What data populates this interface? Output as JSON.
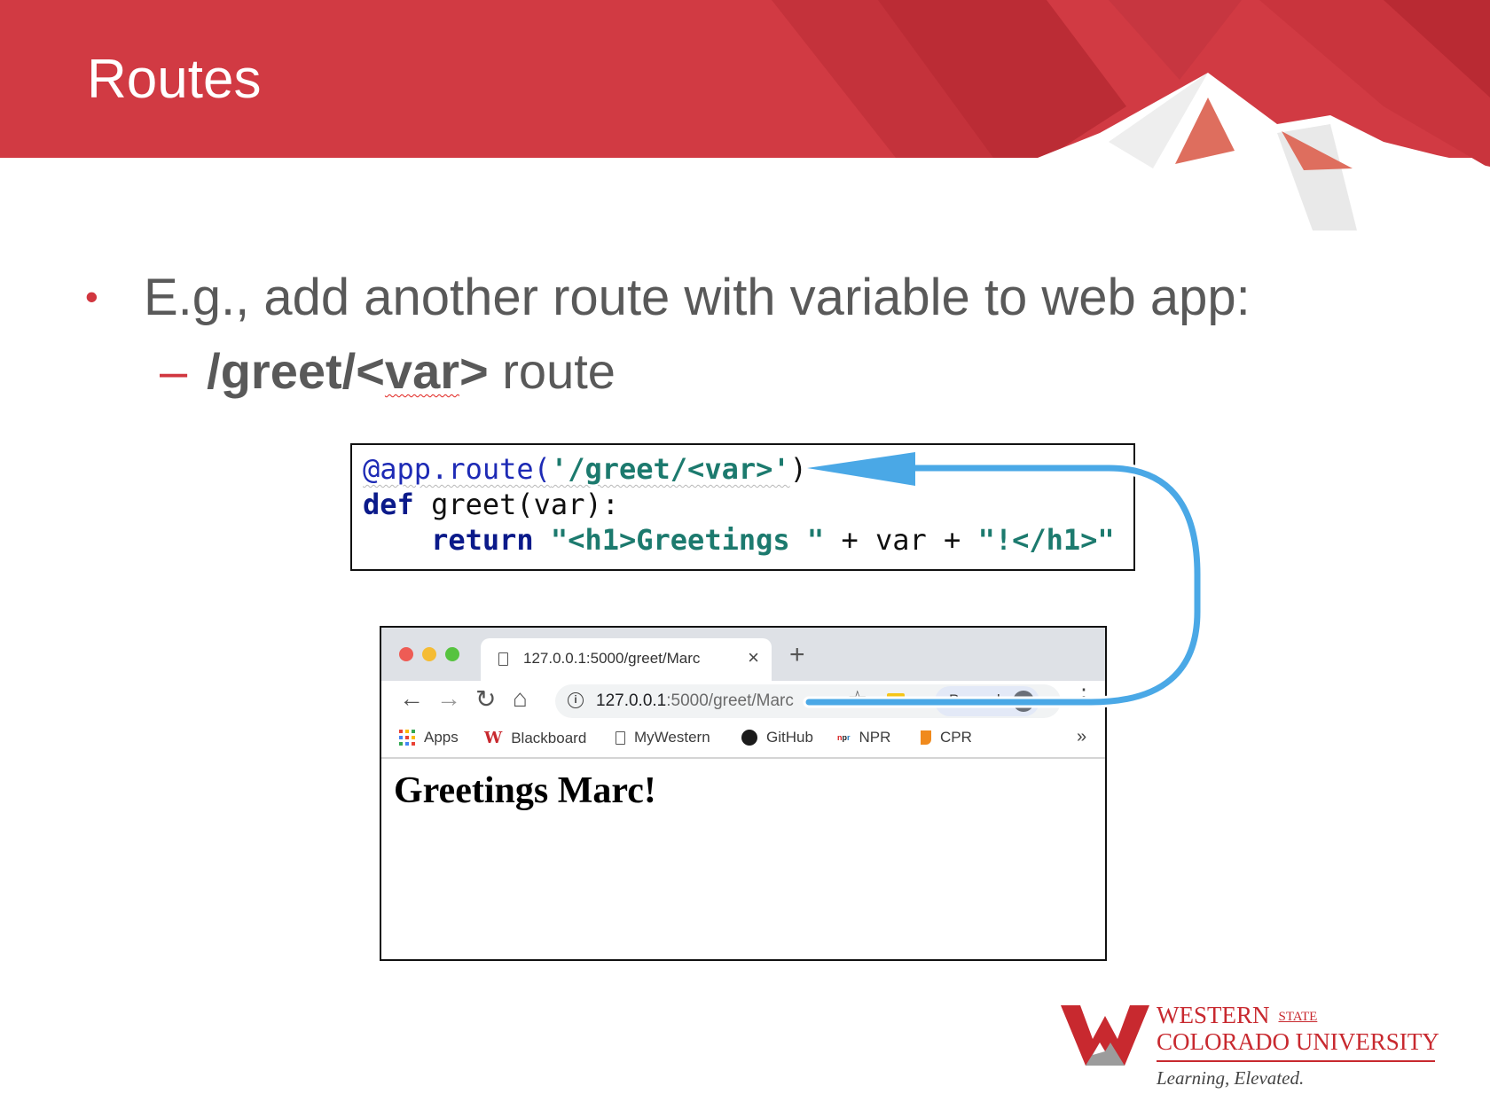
{
  "slide": {
    "title": "Routes",
    "bullet_main": "E.g., add another route with variable to web app:",
    "bullet_dot": "•",
    "sub_dash": "–",
    "sub_route_prefix": "/greet/<",
    "sub_route_var": "var",
    "sub_route_suffix": ">",
    "sub_text": " route"
  },
  "code": {
    "line1": {
      "decorator": "@app.route(",
      "string": "'/greet/<var>'",
      "close": ")"
    },
    "line2": {
      "keyword": "def",
      "rest": " greet(var):"
    },
    "line3": {
      "indent": "    ",
      "keyword": "return",
      "string1": " \"<h1>Greetings \"",
      "mid": " + var + ",
      "string2": "\"!</h1>\""
    }
  },
  "browser": {
    "tab_title": "127.0.0.1:5000/greet/Marc",
    "tab_close": "×",
    "new_tab": "+",
    "nav": {
      "back": "←",
      "forward": "→",
      "reload": "↻",
      "home": "⌂"
    },
    "url_host": "127.0.0.1",
    "url_path": ":5000/greet/Marc",
    "info": "i",
    "star": "☆",
    "profile_label": "Paused",
    "menu": "⋮",
    "bookmarks": [
      "Apps",
      "Blackboard",
      "MyWestern",
      "GitHub",
      "NPR",
      "CPR"
    ],
    "bookmarks_more": "»",
    "npr_mark": "npr",
    "page_heading": "Greetings Marc!"
  },
  "logo": {
    "line1": "WESTERN",
    "state": "STATE",
    "line2": "COLORADO UNIVERSITY",
    "tagline": "Learning, Elevated."
  },
  "colors": {
    "brand_red": "#c8292f",
    "arrow_blue": "#4aa8e6",
    "text_gray": "#595959"
  }
}
